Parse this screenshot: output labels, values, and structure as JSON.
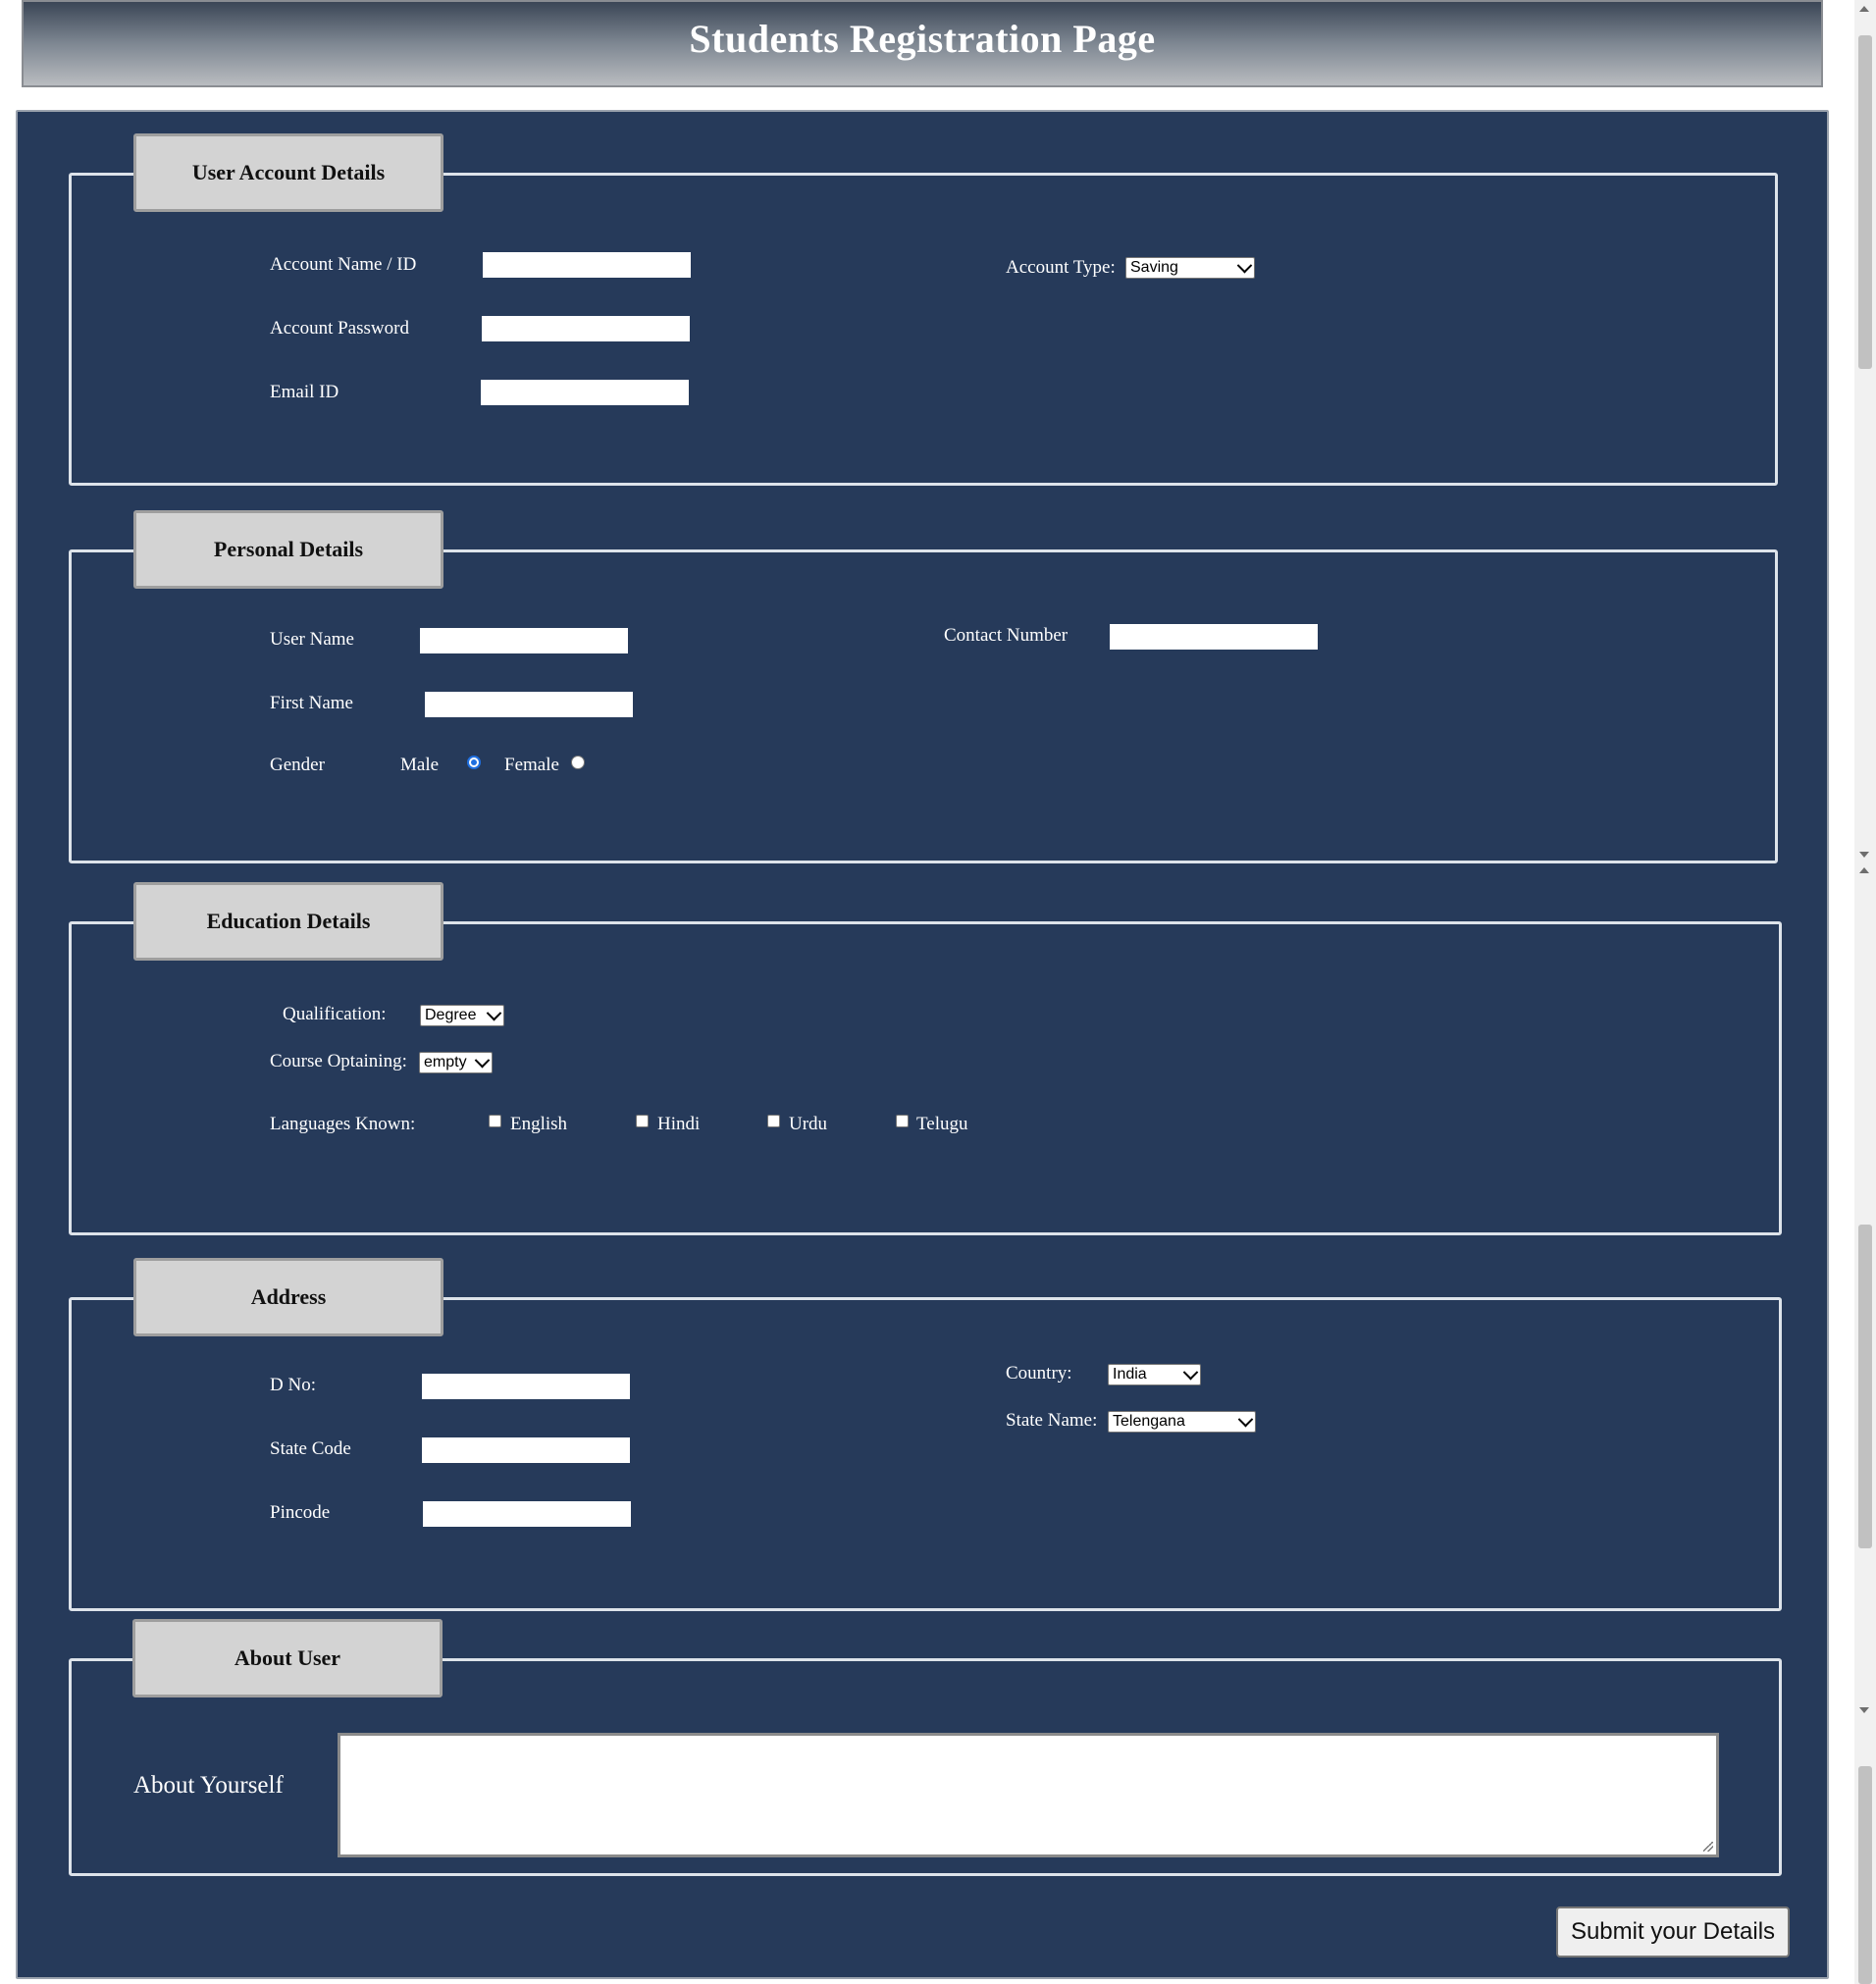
{
  "header": {
    "title": "Students Registration Page"
  },
  "account": {
    "legend": "User Account Details",
    "name_label": "Account Name / ID",
    "name_value": "",
    "password_label": "Account Password",
    "password_value": "",
    "email_label": "Email ID",
    "email_value": "",
    "type_label": "Account Type:",
    "type_value": "Saving"
  },
  "personal": {
    "legend": "Personal Details",
    "username_label": "User Name",
    "username_value": "",
    "firstname_label": "First Name",
    "firstname_value": "",
    "contact_label": "Contact Number",
    "contact_value": "",
    "gender_label": "Gender",
    "male_label": "Male",
    "female_label": "Female",
    "gender_selected": "Male"
  },
  "education": {
    "legend": "Education Details",
    "qualification_label": "Qualification:",
    "qualification_value": "Degree",
    "course_label": "Course Optaining:",
    "course_value": "empty",
    "languages_label": "Languages Known:",
    "languages": [
      {
        "label": "English",
        "checked": false
      },
      {
        "label": "Hindi",
        "checked": false
      },
      {
        "label": "Urdu",
        "checked": false
      },
      {
        "label": "Telugu",
        "checked": false
      }
    ]
  },
  "address": {
    "legend": "Address",
    "dno_label": "D No:",
    "dno_value": "",
    "statecode_label": "State Code",
    "statecode_value": "",
    "pincode_label": "Pincode",
    "pincode_value": "",
    "country_label": "Country:",
    "country_value": "India",
    "state_label": "State Name:",
    "state_value": "Telengana"
  },
  "about": {
    "legend": "About User",
    "label": "About Yourself",
    "value": ""
  },
  "submit_label": "Submit your Details"
}
